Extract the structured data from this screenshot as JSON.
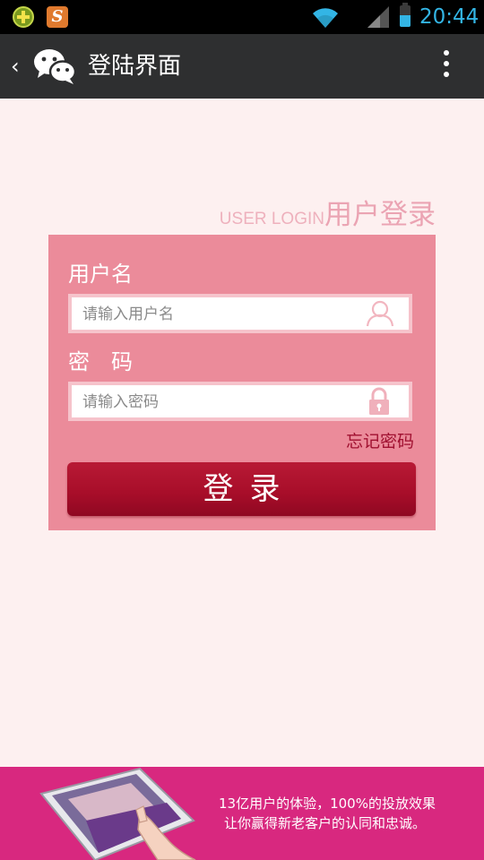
{
  "status_bar": {
    "time": "20:44",
    "icons": [
      "app-notification-icon",
      "sogou-input-icon",
      "wifi-icon",
      "signal-icon",
      "battery-icon"
    ]
  },
  "action_bar": {
    "title": "登陆界面",
    "icons": [
      "back-icon",
      "wechat-icon",
      "overflow-menu-icon"
    ]
  },
  "login": {
    "header_en": "USER LOGIN",
    "header_cn": "用户登录",
    "username_label": "用户名",
    "username_placeholder": "请输入用户名",
    "password_label": "密　码",
    "password_placeholder": "请输入密码",
    "forgot_label": "忘记密码",
    "submit_label": "登录"
  },
  "ad": {
    "line1": "13亿用户的体验，100%的投放效果",
    "line2": "让你赢得新老客户的认同和忠诚。"
  },
  "colors": {
    "background": "#fdf0f0",
    "card": "#eb8b9a",
    "button": "#a70d29",
    "action_bar": "#2e2f30",
    "status_accent": "#33b5e5",
    "banner": "#d8287f"
  }
}
